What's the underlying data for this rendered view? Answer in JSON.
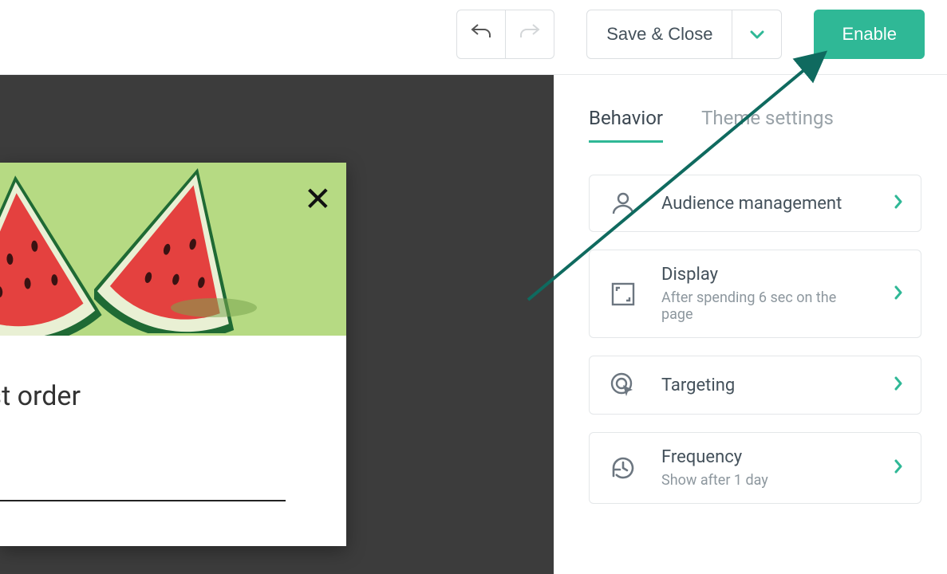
{
  "toolbar": {
    "save_label": "Save & Close",
    "enable_label": "Enable"
  },
  "tabs": {
    "behavior": "Behavior",
    "theme": "Theme settings"
  },
  "cards": {
    "audience": {
      "title": "Audience management"
    },
    "display": {
      "title": "Display",
      "sub": "After spending 6 sec on the page"
    },
    "targeting": {
      "title": "Targeting"
    },
    "frequency": {
      "title": "Frequency",
      "sub": "Show after 1 day"
    }
  },
  "popup": {
    "headline": "f your first order"
  },
  "colors": {
    "accent": "#2fb896"
  }
}
